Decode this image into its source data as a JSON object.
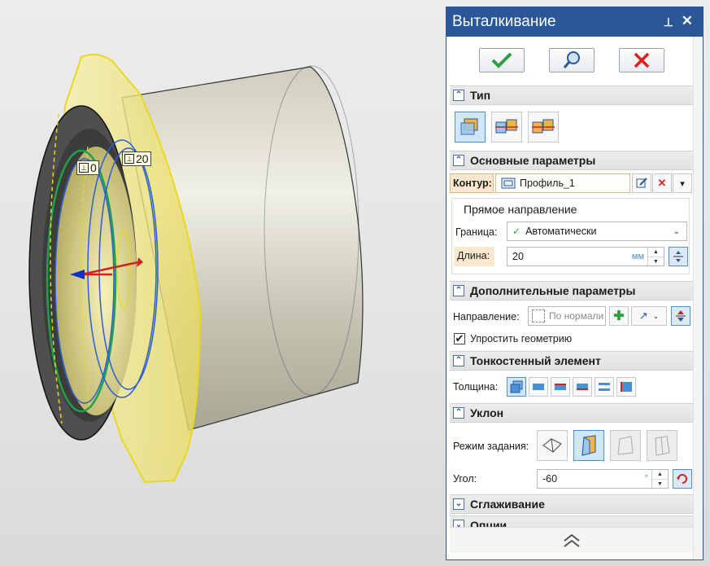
{
  "panel": {
    "title": "Выталкивание",
    "sections": {
      "type": "Тип",
      "main": "Основные параметры",
      "extra": "Дополнительные параметры",
      "thin": "Тонкостенный элемент",
      "draft": "Уклон",
      "smooth": "Сглаживание",
      "options": "Опции"
    },
    "contour": {
      "label": "Контур:",
      "value": "Профиль_1"
    },
    "forward": {
      "heading": "Прямое направление",
      "boundary_label": "Граница:",
      "boundary_value": "Автоматически",
      "length_label": "Длина:",
      "length_value": "20",
      "length_unit": "мм"
    },
    "direction": {
      "label": "Направление:",
      "placeholder": "По нормали"
    },
    "simplify": {
      "label": "Упростить геометрию",
      "checked": true
    },
    "thickness_label": "Толщина:",
    "draft": {
      "mode_label": "Режим задания:",
      "angle_label": "Угол:",
      "angle_value": "-60",
      "angle_unit": "°"
    }
  },
  "viewport": {
    "dim_labels": [
      "0",
      "20"
    ]
  },
  "colors": {
    "accent": "#2b5797",
    "ok": "#2ea043",
    "cancel": "#e02020",
    "highlight": "#f2e24a"
  }
}
